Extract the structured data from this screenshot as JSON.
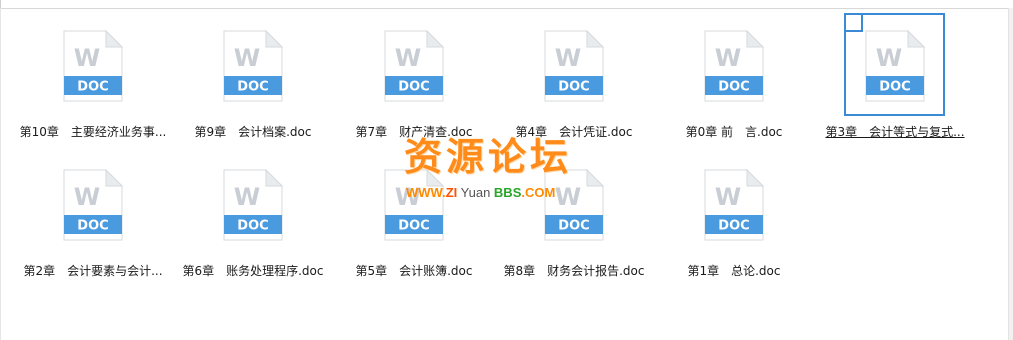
{
  "file_icon": {
    "badge_text": "DOC",
    "letter": "W",
    "badge_color": "#4a9ae0",
    "letter_color": "#c9ced4"
  },
  "files": [
    {
      "name": "第10章　主要经济业务事..."
    },
    {
      "name": "第9章　会计档案.doc"
    },
    {
      "name": "第7章　财产清查.doc"
    },
    {
      "name": "第4章　会计凭证.doc"
    },
    {
      "name": "第0章 前　言.doc"
    },
    {
      "name": "第3章　会计等式与复式...",
      "selected": true
    },
    {
      "name": "第2章　会计要素与会计..."
    },
    {
      "name": "第6章　账务处理程序.doc"
    },
    {
      "name": "第5章　会计账簿.doc"
    },
    {
      "name": "第8章　财务会计报告.doc"
    },
    {
      "name": "第1章　总论.doc"
    }
  ],
  "watermark": {
    "title": "资源论坛",
    "url_part1": "WWW.",
    "url_part2": "ZI",
    "url_part3": " Yuan ",
    "url_part4": "BBS",
    "url_part5": ".COM"
  },
  "colors": {
    "selection_border": "#3a8ad6"
  }
}
